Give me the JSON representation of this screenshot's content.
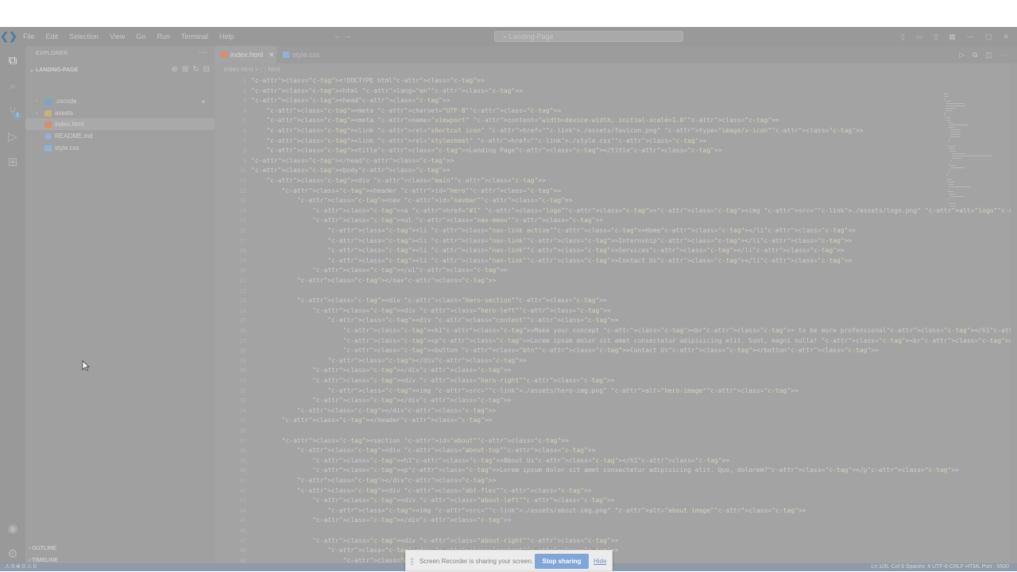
{
  "titlebar": {
    "menu": [
      "File",
      "Edit",
      "Selection",
      "View",
      "Go",
      "Run",
      "Terminal",
      "Help"
    ],
    "search": "Landing-Page"
  },
  "sidebar": {
    "title": "EXPLORER",
    "folder": "LANDING-PAGE",
    "items": [
      {
        "name": ".vscode",
        "type": "folder",
        "color": "#7da3c9"
      },
      {
        "name": "assets",
        "type": "folder",
        "color": "#c9b27a"
      },
      {
        "name": "index.html",
        "type": "html",
        "color": "#d98c6e"
      },
      {
        "name": "README.md",
        "type": "info",
        "color": "#8fb2d6"
      },
      {
        "name": "style.css",
        "type": "css",
        "color": "#8fb2d6"
      }
    ],
    "outline": "OUTLINE",
    "timeline": "TIMELINE"
  },
  "editor": {
    "tabs": [
      {
        "label": "index.html",
        "active": true
      },
      {
        "label": "style.css",
        "active": false
      }
    ],
    "breadcrumb": "index.html > ⬚ html",
    "lines": [
      "<!DOCTYPE html>",
      "<html lang=\"en\">",
      "<head>",
      "    <meta charset=\"UTF-8\">",
      "    <meta name=\"viewport\" content=\"width=device-width, initial-scale=1.0\">",
      "    <link rel=\"shortcut icon\" href=\"./assets/favicon.png\" type=\"image/x-icon\">",
      "    <link rel=\"stylesheet\" href=\"./style.css\">",
      "    <title>Landing Page</title>",
      "</head>",
      "<body>",
      "    <div class=\"main\">",
      "        <header id=\"hero\">",
      "            <nav id=\"navbar\">",
      "                <a href=\"#1\" class=\"logo\"><img src=\"./assets/logo.png\" alt=\"logo\"></a>",
      "                <ul class=\"nav-menu\">",
      "                    <li class=\"nav-link active\">Home</li>",
      "                    <li class=\"nav-link\">Internship</li>",
      "                    <li class=\"nav-link\">Services</li>",
      "                    <li class=\"nav-link\">Contact Us</li>",
      "                </ul>",
      "            </nav>",
      "",
      "            <div class=\"hero-section\">",
      "                <div class=\"hero-left\">",
      "                    <div class=\"content\">",
      "                        <h1>Make your concept <br> to be more professional</h1>",
      "                        <p>Lorem ipsum dolor sit amet consectetur adipisicing elit. Sunt, magni nulla! <br> Facere sed recusandae perspiciatis labore, voluptates quo! Ea,",
      "                        <button class=\"btn\">Contact Us</button>",
      "                    </div>",
      "                </div>",
      "                <div class=\"hero-right\">",
      "                    <img src=\"./assets/hero-img.png\" alt=\"hero-image\">",
      "                </div>",
      "            </div>",
      "        </header>",
      "",
      "        <section id=\"about\">",
      "            <div class=\"about-top\">",
      "                <h1>About Us</h1>",
      "                <p>Lorem ipsum dolor sit amet consectetur adipisicing elit. Quo, dolorem?</p>",
      "            </div>",
      "            <div class=\"abt-flex\">",
      "                <div class=\"about-left\">",
      "                    <img src=\"./assets/about-img.png\" alt=\"about image\">",
      "                </div>",
      "",
      "                <div class=\"about-right\">",
      "                    <div class=\"content\">",
      "                        <h3>We Are Lea"
    ]
  },
  "statusbar": {
    "left": "⚠ 0  ⊗ 0  ⚠ 0",
    "right": "Ln 106, Col 6   Spaces: 4   UTF-8   CRLF   HTML   Port : 5500"
  },
  "share_toast": {
    "message": "Screen Recorder is sharing your screen.",
    "stop_label": "Stop sharing",
    "hide_label": "Hide"
  }
}
